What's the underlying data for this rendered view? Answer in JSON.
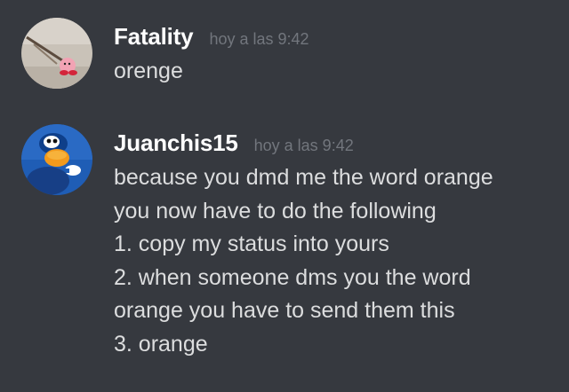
{
  "messages": [
    {
      "username": "Fatality",
      "timestamp": "hoy a las 9:42",
      "avatar_icon": "kirby-figure-avatar",
      "lines": [
        "orenge"
      ]
    },
    {
      "username": "Juanchis15",
      "timestamp": "hoy a las 9:42",
      "avatar_icon": "penguin-avatar",
      "lines": [
        "because you dmd me the word orange",
        "you now have to do the following",
        "1. copy my status into yours",
        "2. when someone dms you the word",
        "orange you have to send them this",
        "3. orange"
      ]
    }
  ],
  "colors": {
    "background": "#36393f",
    "username": "#ffffff",
    "timestamp": "#72767d",
    "message_text": "#dcddde"
  }
}
